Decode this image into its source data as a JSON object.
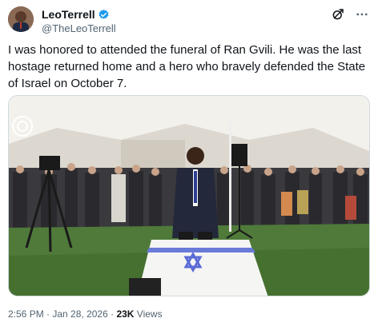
{
  "author": {
    "display_name": "LeoTerrell",
    "handle": "@TheLeoTerrell"
  },
  "tweet": {
    "text": "I was honored to attended the funeral of Ran Gvili. He was the last hostage returned home and a hero who bravely defended the State of Israel on October 7."
  },
  "meta": {
    "time": "2:56 PM",
    "separator1": " · ",
    "date": "Jan 28, 2026",
    "separator2": " · ",
    "views_count": "23K",
    "views_label": " Views"
  },
  "icons": {
    "verified": "verified-badge-icon",
    "grok": "grok-icon",
    "more": "more-icon"
  },
  "colors": {
    "verified": "#1d9bf0",
    "flag_blue": "#5b6bd6",
    "grass": "#4f7a3a"
  }
}
